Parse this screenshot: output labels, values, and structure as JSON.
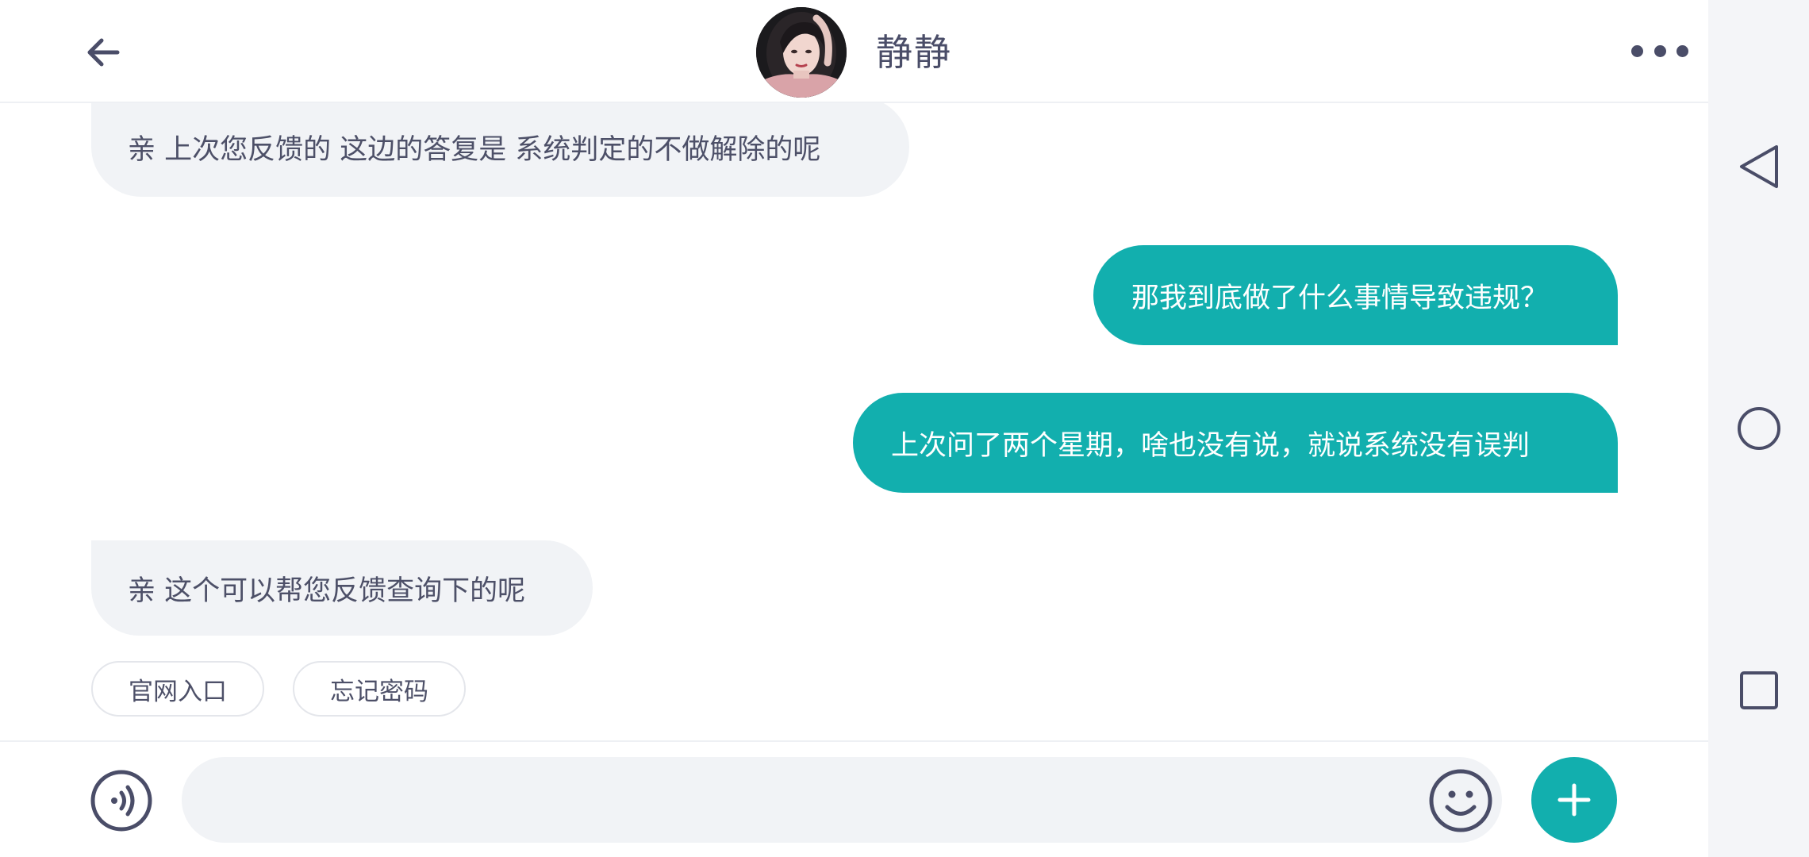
{
  "header": {
    "contact_name": "静静"
  },
  "messages": [
    {
      "direction": "in",
      "text": "亲 上次您反馈的 这边的答复是 系统判定的不做解除的呢"
    },
    {
      "direction": "out",
      "text": "那我到底做了什么事情导致违规？"
    },
    {
      "direction": "out",
      "text": "上次问了两个星期，啥也没有说，就说系统没有误判"
    },
    {
      "direction": "in",
      "text": "亲 这个可以帮您反馈查询下的呢"
    }
  ],
  "quick_replies": [
    "官网入口",
    "忘记密码"
  ],
  "input": {
    "value": "",
    "placeholder": ""
  },
  "icons": {
    "back": "arrow-left-icon",
    "more": "more-dots-icon",
    "voice": "voice-icon",
    "emoji": "emoji-icon",
    "plus": "plus-icon",
    "sys_back": "triangle-back-icon",
    "sys_home": "circle-home-icon",
    "sys_recent": "square-recent-icon"
  },
  "colors": {
    "accent": "#12afae",
    "incoming_bubble": "#f1f3f6",
    "text_dark": "#4a4d68"
  }
}
